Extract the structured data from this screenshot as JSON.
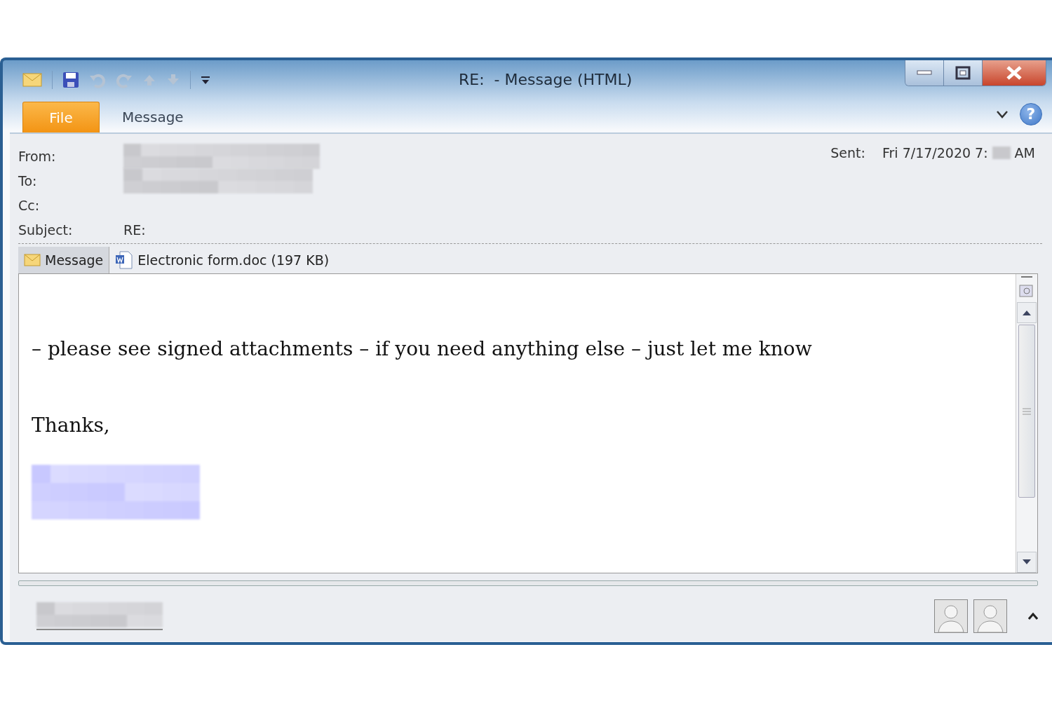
{
  "window": {
    "title": "RE:  - Message (HTML)"
  },
  "help_button": {
    "label": "?"
  },
  "ribbon_tabs": [
    {
      "label": "File",
      "kind": "file"
    },
    {
      "label": "Message",
      "kind": "tab"
    }
  ],
  "header": {
    "fields": [
      {
        "label": "From:",
        "redacted": true
      },
      {
        "label": "To:",
        "redacted": true
      },
      {
        "label": "Cc:",
        "redacted": false
      },
      {
        "label": "Subject:",
        "value": "RE:",
        "redacted": false
      }
    ],
    "sent_label": "Sent:",
    "sent_date": "Fri 7/17/2020 7:",
    "sent_time_redacted": true,
    "sent_suffix": "AM"
  },
  "attachments": [
    {
      "label": "Message",
      "kind": "message",
      "selected": true
    },
    {
      "label": "Electronic form.doc (197 KB)",
      "kind": "document",
      "selected": false
    }
  ],
  "body": {
    "paragraphs": [
      "– please see signed attachments – if you need anything else – just let me know",
      "Thanks,"
    ],
    "signature_redacted": true
  },
  "people_pane": {
    "name_redacted": true
  }
}
